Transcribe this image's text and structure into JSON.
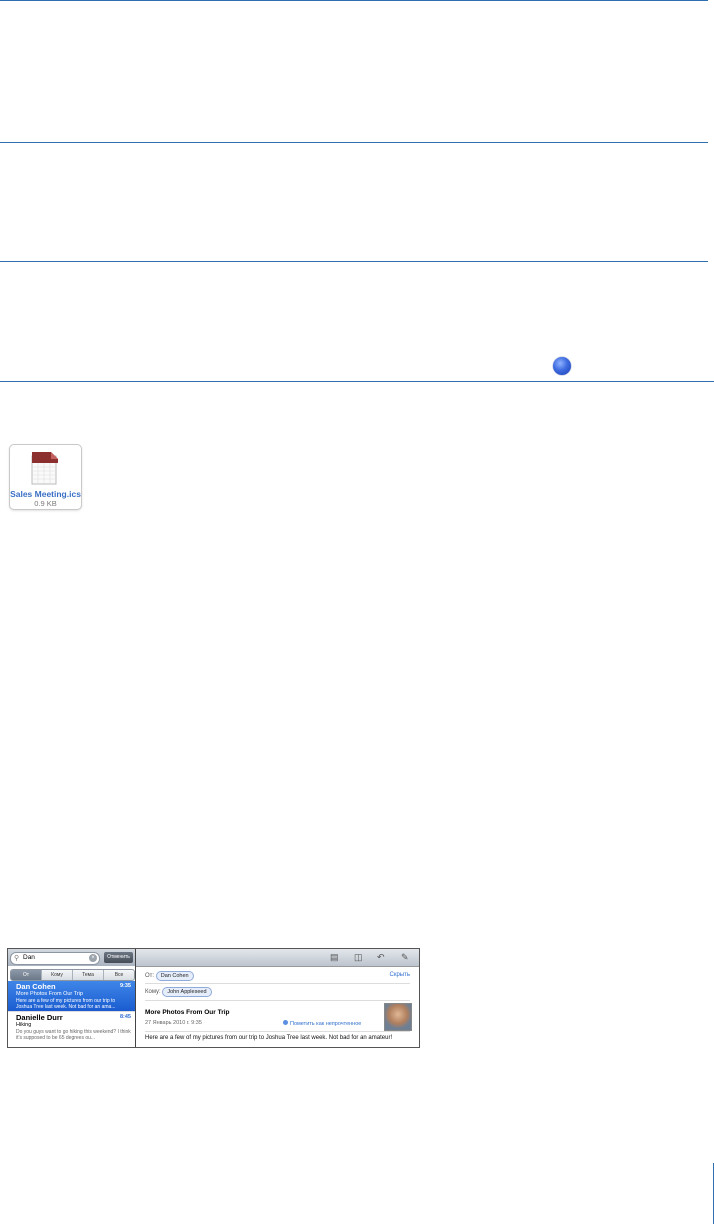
{
  "attachment": {
    "filename": "Sales Meeting.ics",
    "size": "0.9 KB"
  },
  "mail": {
    "search": {
      "query": "Dan",
      "cancel_label": "Отменить"
    },
    "scopes": [
      "От",
      "Кому",
      "Тема",
      "Все"
    ],
    "messages": [
      {
        "sender": "Dan Cohen",
        "time": "9:35",
        "subject": "More Photos From Our Trip",
        "preview": "Here are a few of my pictures from our trip to Joshua Tree last week. Not bad for an ama..."
      },
      {
        "sender": "Danielle Durr",
        "time": "8:45",
        "subject": "Hiking",
        "preview": "Do you guys want to go hiking this weekend? I think it's supposed to be 65 degrees ou..."
      }
    ],
    "detail": {
      "from_label": "От:",
      "from": "Dan Cohen",
      "to_label": "Кому:",
      "to": "John Appleseed",
      "hide_label": "Скрыть",
      "subject": "More Photos From Our Trip",
      "date": "27 Январь 2010 г. 9:35",
      "mark_unread": "Пометить как непрочтенное",
      "body": "Here are a few of my pictures from our trip to Joshua Tree last week. Not bad for an amateur!"
    },
    "icons": [
      "folder-icon",
      "trash-icon",
      "reply-icon",
      "compose-icon"
    ]
  }
}
